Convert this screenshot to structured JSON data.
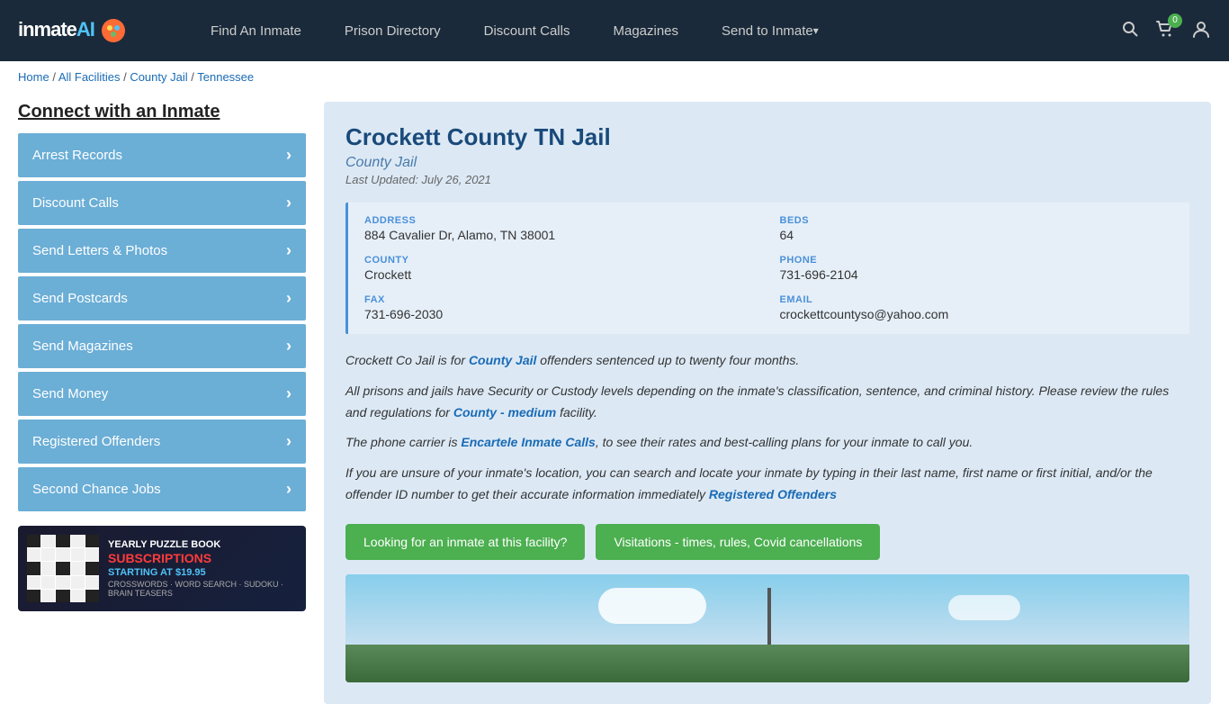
{
  "header": {
    "logo_text": "inmate",
    "logo_ai": "AI",
    "nav": [
      {
        "label": "Find An Inmate",
        "id": "find-inmate",
        "dropdown": false
      },
      {
        "label": "Prison Directory",
        "id": "prison-directory",
        "dropdown": false
      },
      {
        "label": "Discount Calls",
        "id": "discount-calls",
        "dropdown": false
      },
      {
        "label": "Magazines",
        "id": "magazines",
        "dropdown": false
      },
      {
        "label": "Send to Inmate",
        "id": "send-to-inmate",
        "dropdown": true
      }
    ],
    "cart_count": "0"
  },
  "breadcrumb": {
    "home": "Home",
    "all_facilities": "All Facilities",
    "county_jail": "County Jail",
    "state": "Tennessee"
  },
  "sidebar": {
    "title": "Connect with an Inmate",
    "items": [
      {
        "label": "Arrest Records",
        "id": "arrest-records"
      },
      {
        "label": "Discount Calls",
        "id": "discount-calls"
      },
      {
        "label": "Send Letters & Photos",
        "id": "send-letters"
      },
      {
        "label": "Send Postcards",
        "id": "send-postcards"
      },
      {
        "label": "Send Magazines",
        "id": "send-magazines"
      },
      {
        "label": "Send Money",
        "id": "send-money"
      },
      {
        "label": "Registered Offenders",
        "id": "registered-offenders"
      },
      {
        "label": "Second Chance Jobs",
        "id": "second-chance-jobs"
      }
    ],
    "ad": {
      "line1": "YEARLY PUZZLE BOOK",
      "line2": "SUBSCRIPTIONS",
      "line3": "STARTING AT $19.95",
      "line4": "CROSSWORDS · WORD SEARCH · SUDOKU · BRAIN TEASERS"
    }
  },
  "facility": {
    "title": "Crockett County TN Jail",
    "subtitle": "County Jail",
    "last_updated": "Last Updated: July 26, 2021",
    "address_label": "ADDRESS",
    "address_value": "884 Cavalier Dr, Alamo, TN 38001",
    "beds_label": "BEDS",
    "beds_value": "64",
    "county_label": "COUNTY",
    "county_value": "Crockett",
    "phone_label": "PHONE",
    "phone_value": "731-696-2104",
    "fax_label": "FAX",
    "fax_value": "731-696-2030",
    "email_label": "EMAIL",
    "email_value": "crockettcountyso@yahoo.com",
    "desc1": "Crockett Co Jail is for County Jail offenders sentenced up to twenty four months.",
    "desc2": "All prisons and jails have Security or Custody levels depending on the inmate's classification, sentence, and criminal history. Please review the rules and regulations for County - medium facility.",
    "desc3": "The phone carrier is Encartele Inmate Calls, to see their rates and best-calling plans for your inmate to call you.",
    "desc4": "If you are unsure of your inmate's location, you can search and locate your inmate by typing in their last name, first name or first initial, and/or the offender ID number to get their accurate information immediately Registered Offenders",
    "btn1": "Looking for an inmate at this facility?",
    "btn2": "Visitations - times, rules, Covid cancellations"
  }
}
